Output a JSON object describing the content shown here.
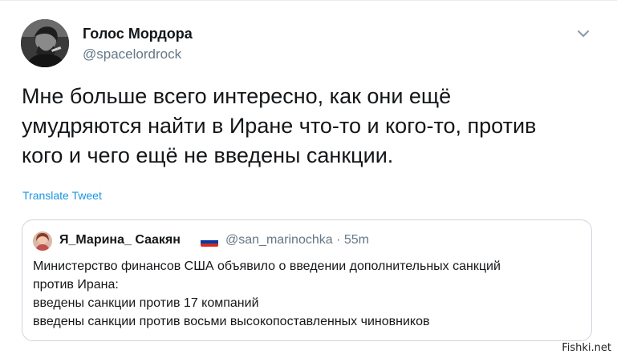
{
  "tweet": {
    "author_name": "Голос Мордора",
    "author_handle": "@spacelordrock",
    "text_lines": [
      "Мне больше всего интересно, как они ещё",
      "умудряются найти в Иране что-то и кого-то, против",
      "кого и чего ещё не введены санкции."
    ],
    "translate_label": "Translate Tweet",
    "menu_icon": "chevron-down-icon"
  },
  "quote": {
    "author_name": "Я_Марина_ Саакян",
    "flag_icon": "russia-flag-icon",
    "flag_colors": [
      "#ffffff",
      "#0039a6",
      "#d52b1e"
    ],
    "author_handle": "@san_marinochka · 55m",
    "text_lines": [
      "Министерство финансов США объявило о введении дополнительных санкций",
      "против Ирана:",
      "введены санкции против 17 компаний",
      "введены санкции против восьми высокопоставленных чиновников"
    ]
  },
  "watermark": {
    "text": "Fishki.net"
  },
  "colors": {
    "text": "#14171a",
    "secondary": "#657786",
    "link": "#1b95e0",
    "border": "#ccd6dd"
  }
}
